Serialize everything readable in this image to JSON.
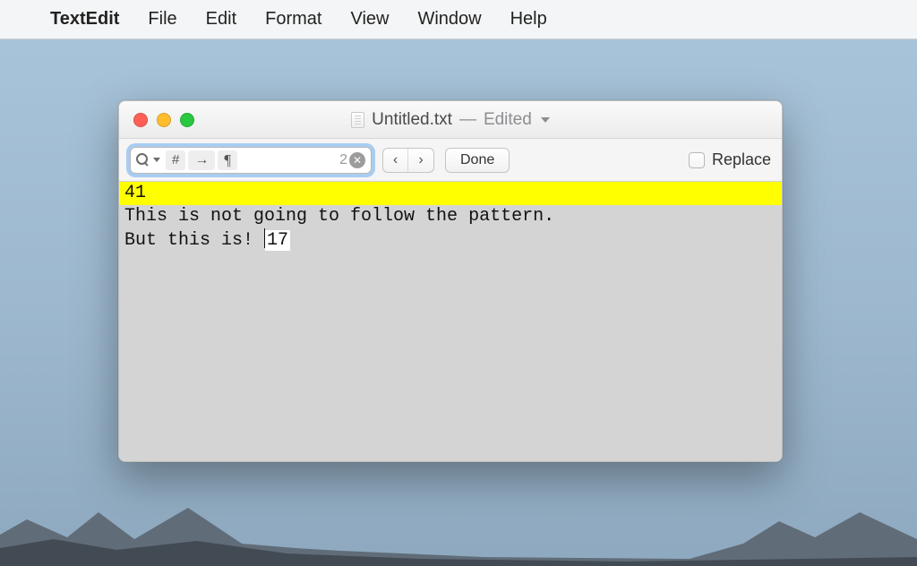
{
  "menubar": {
    "app_name": "TextEdit",
    "items": [
      "File",
      "Edit",
      "Format",
      "View",
      "Window",
      "Help"
    ]
  },
  "window": {
    "title_filename": "Untitled.txt",
    "title_status": "Edited"
  },
  "findbar": {
    "tokens": {
      "hash": "#",
      "arrow": "→",
      "paragraph": "¶"
    },
    "match_count": "2",
    "prev_label": "‹",
    "next_label": "›",
    "done_label": "Done",
    "replace_label": "Replace"
  },
  "editor": {
    "line1": "41",
    "line2": "This is not going to follow the pattern.",
    "line3_prefix": "But this is! ",
    "line3_match": "17"
  }
}
